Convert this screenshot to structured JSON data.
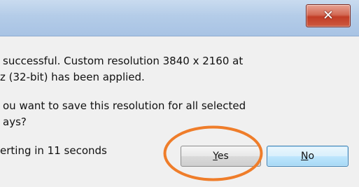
{
  "dialog": {
    "close_glyph": "✕",
    "message_lines": [
      "successful. Custom resolution 3840 x 2160 at",
      "z (32-bit) has been applied.",
      "ou want to save this resolution for all selected",
      "ays?"
    ],
    "countdown": "erting in 11 seconds",
    "yes_mnemonic": "Y",
    "yes_rest": "es",
    "no_mnemonic": "N",
    "no_rest": "o"
  },
  "annotation": {
    "highlight_color": "#ef7d2a"
  }
}
